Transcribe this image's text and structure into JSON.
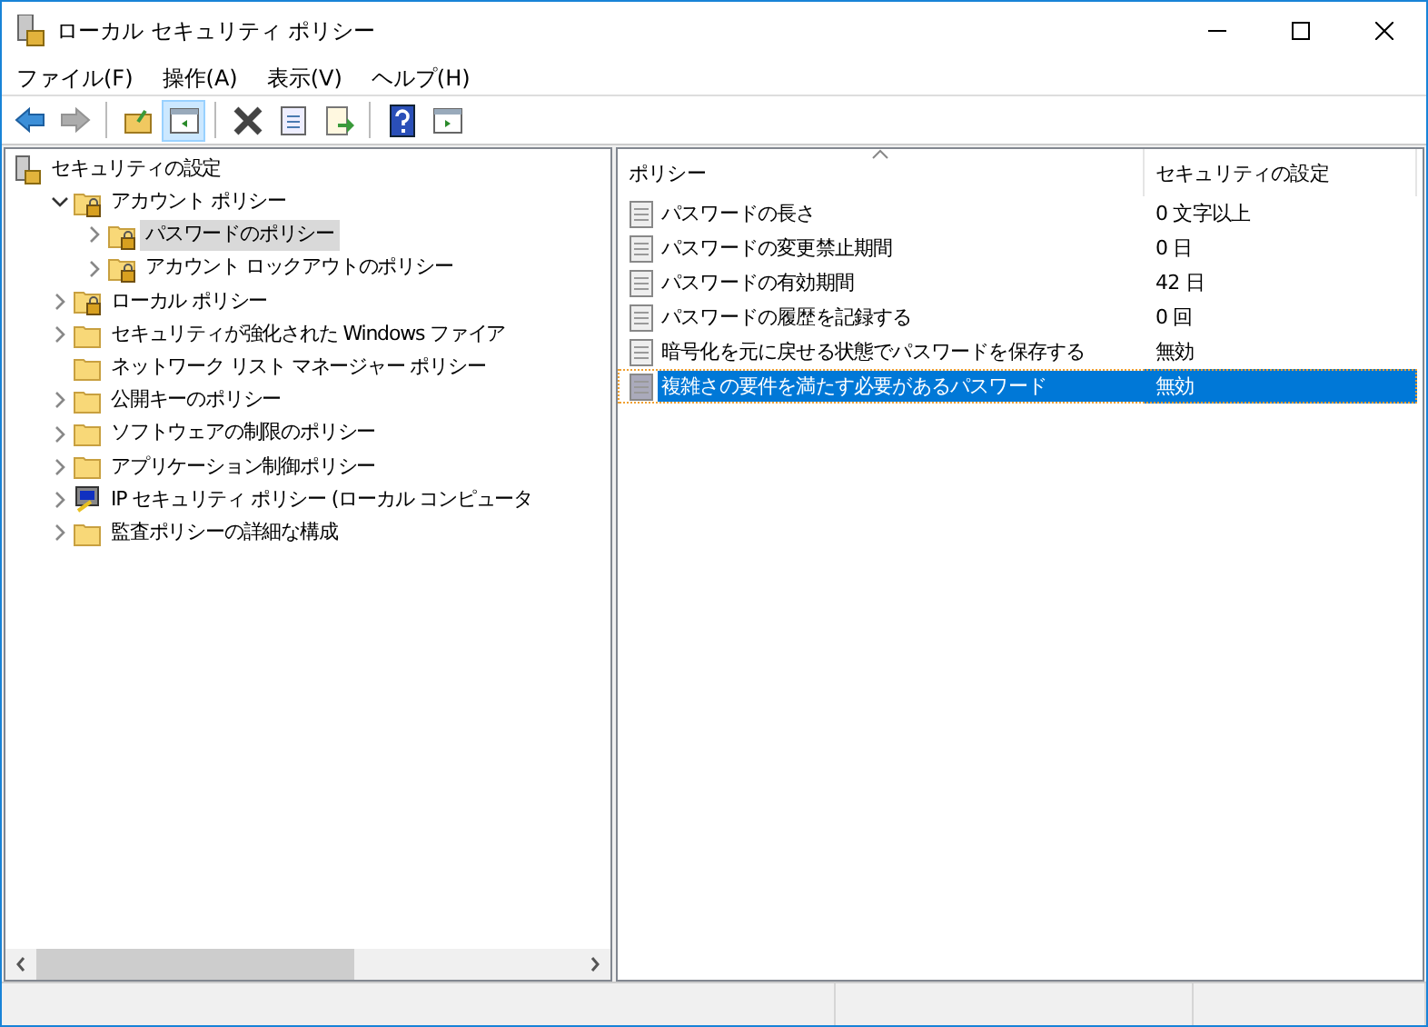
{
  "window": {
    "title": "ローカル セキュリティ ポリシー"
  },
  "menu": [
    {
      "label": "ファイル(F)"
    },
    {
      "label": "操作(A)"
    },
    {
      "label": "表示(V)"
    },
    {
      "label": "ヘルプ(H)"
    }
  ],
  "toolbar": [
    {
      "kind": "back",
      "disabled": false,
      "pressed": false
    },
    {
      "kind": "forward",
      "disabled": true,
      "pressed": false
    },
    {
      "kind": "sep"
    },
    {
      "kind": "up",
      "disabled": false,
      "pressed": false
    },
    {
      "kind": "tree",
      "disabled": false,
      "pressed": true
    },
    {
      "kind": "sep"
    },
    {
      "kind": "delete",
      "disabled": false,
      "pressed": false
    },
    {
      "kind": "properties",
      "disabled": false,
      "pressed": false
    },
    {
      "kind": "export",
      "disabled": false,
      "pressed": false
    },
    {
      "kind": "sep"
    },
    {
      "kind": "help",
      "disabled": false,
      "pressed": false
    },
    {
      "kind": "pane",
      "disabled": false,
      "pressed": false
    }
  ],
  "tree": [
    {
      "label": "セキュリティの設定",
      "kind": "server",
      "selected": false,
      "children": [
        {
          "label": "アカウント ポリシー",
          "kind": "lockfolder",
          "expanded": true,
          "selected": false,
          "children": [
            {
              "label": "パスワードのポリシー",
              "kind": "lockfolder",
              "expanded": false,
              "has_children": true,
              "selected": true
            },
            {
              "label": "アカウント ロックアウトのポリシー",
              "kind": "lockfolder",
              "expanded": false,
              "has_children": true,
              "selected": false
            }
          ]
        },
        {
          "label": "ローカル ポリシー",
          "kind": "lockfolder",
          "expanded": false,
          "has_children": true,
          "selected": false
        },
        {
          "label": "セキュリティが強化された Windows ファイア",
          "kind": "folder",
          "expanded": false,
          "has_children": true,
          "selected": false
        },
        {
          "label": "ネットワーク リスト マネージャー ポリシー",
          "kind": "folder",
          "expanded": false,
          "has_children": false,
          "selected": false
        },
        {
          "label": "公開キーのポリシー",
          "kind": "folder",
          "expanded": false,
          "has_children": true,
          "selected": false
        },
        {
          "label": "ソフトウェアの制限のポリシー",
          "kind": "folder",
          "expanded": false,
          "has_children": true,
          "selected": false
        },
        {
          "label": "アプリケーション制御ポリシー",
          "kind": "folder",
          "expanded": false,
          "has_children": true,
          "selected": false
        },
        {
          "label": "IP セキュリティ ポリシー (ローカル コンピュータ",
          "kind": "ipsec",
          "expanded": false,
          "has_children": true,
          "selected": false
        },
        {
          "label": "監査ポリシーの詳細な構成",
          "kind": "folder",
          "expanded": false,
          "has_children": true,
          "selected": false
        }
      ]
    }
  ],
  "table": {
    "columns": [
      {
        "label": "ポリシー",
        "sorted": true
      },
      {
        "label": "セキュリティの設定"
      }
    ],
    "rows": [
      {
        "policy": "パスワードの長さ",
        "setting": "0 文字以上",
        "selected": false
      },
      {
        "policy": "パスワードの変更禁止期間",
        "setting": "0 日",
        "selected": false
      },
      {
        "policy": "パスワードの有効期間",
        "setting": "42 日",
        "selected": false
      },
      {
        "policy": "パスワードの履歴を記録する",
        "setting": "0 回",
        "selected": false
      },
      {
        "policy": "暗号化を元に戻せる状態でパスワードを保存する",
        "setting": "無効",
        "selected": false
      },
      {
        "policy": "複雑さの要件を満たす必要があるパスワード",
        "setting": "無効",
        "selected": true
      }
    ]
  }
}
